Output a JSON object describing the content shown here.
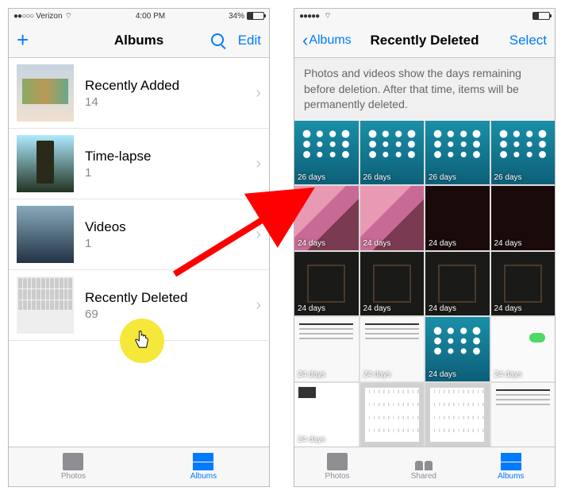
{
  "left": {
    "status": {
      "carrier": "Verizon",
      "time": "4:00 PM",
      "battery": "34%",
      "signal": "●●○○○"
    },
    "nav": {
      "title": "Albums",
      "edit": "Edit"
    },
    "albums": [
      {
        "name": "Recently Added",
        "count": "14"
      },
      {
        "name": "Time-lapse",
        "count": "1"
      },
      {
        "name": "Videos",
        "count": "1"
      },
      {
        "name": "Recently Deleted",
        "count": "69"
      }
    ],
    "tabs": {
      "photos": "Photos",
      "albums": "Albums"
    }
  },
  "right": {
    "status": {
      "carrier": "",
      "time": "",
      "signal": "●●●●●"
    },
    "nav": {
      "back": "Albums",
      "title": "Recently Deleted",
      "select": "Select"
    },
    "banner": "Photos and videos show the days remaining before deletion. After that time, items will be permanently deleted.",
    "grid_badges": [
      "26 days",
      "26 days",
      "26 days",
      "26 days",
      "24 days",
      "24 days",
      "24 days",
      "24 days",
      "24 days",
      "24 days",
      "24 days",
      "24 days",
      "24 days",
      "24 days",
      "24 days",
      "24 days",
      "24 days"
    ],
    "tabs": {
      "photos": "Photos",
      "shared": "Shared",
      "albums": "Albums"
    }
  }
}
